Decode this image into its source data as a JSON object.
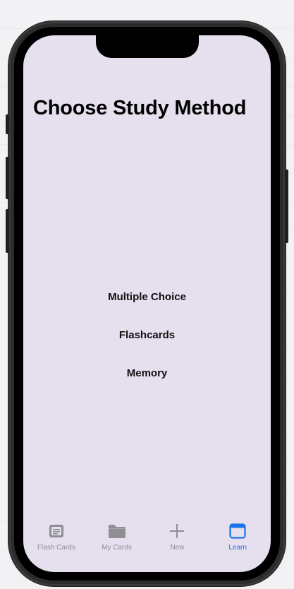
{
  "screen": {
    "title": "Choose Study Method",
    "background": "#e5dfee"
  },
  "methods": [
    {
      "label": "Multiple Choice"
    },
    {
      "label": "Flashcards"
    },
    {
      "label": "Memory"
    }
  ],
  "tabbar": {
    "active_color": "#1a73e8",
    "inactive_color": "#8e8e93",
    "tabs": [
      {
        "label": "Flash Cards",
        "icon": "flashcard-icon",
        "active": false
      },
      {
        "label": "My Cards",
        "icon": "folder-icon",
        "active": false
      },
      {
        "label": "New",
        "icon": "plus-icon",
        "active": false
      },
      {
        "label": "Learn",
        "icon": "window-icon",
        "active": true
      }
    ]
  }
}
